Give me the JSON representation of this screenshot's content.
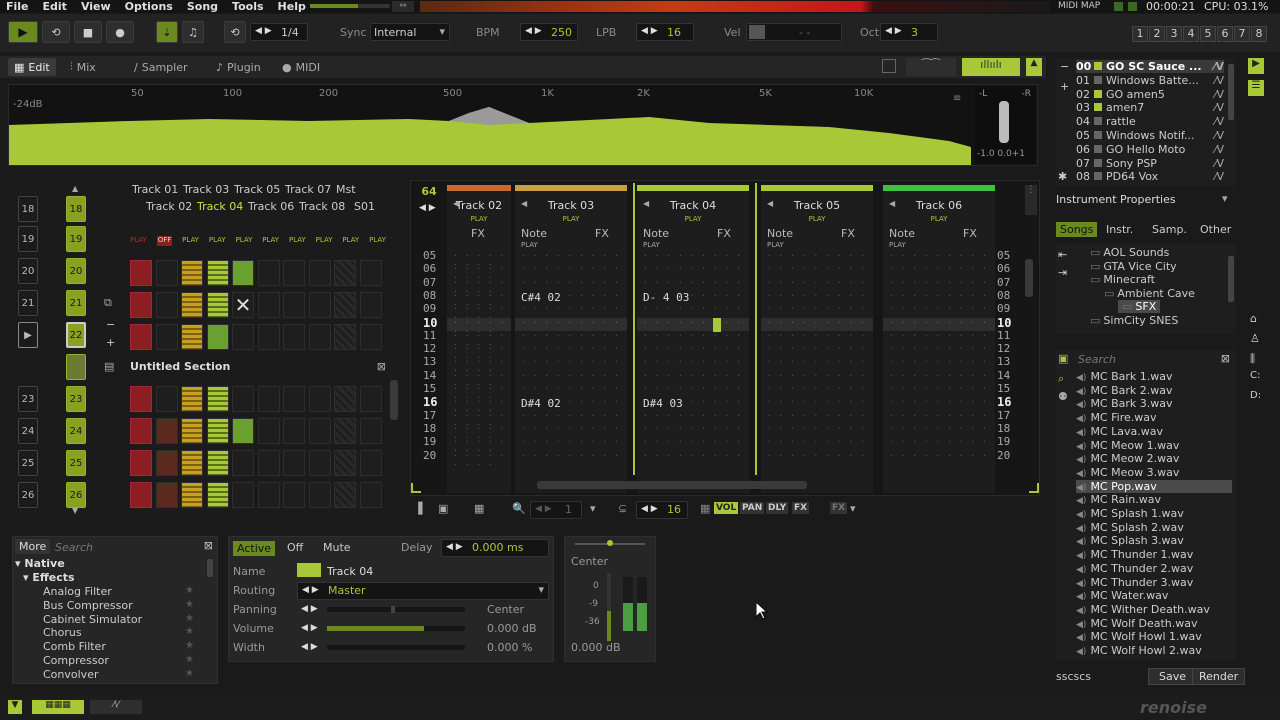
{
  "menu": [
    "File",
    "Edit",
    "View",
    "Options",
    "Song",
    "Tools",
    "Help"
  ],
  "topright": {
    "midi_map": "MIDI MAP",
    "time": "00:00:21",
    "cpu": "CPU: 03.1%"
  },
  "transport": {
    "pattern_pos": "1/4",
    "sync_label": "Sync",
    "sync_value": "Internal",
    "bpm_label": "BPM",
    "bpm": "250",
    "lpb_label": "LPB",
    "lpb": "16",
    "vel_label": "Vel",
    "vel": "- -",
    "oct_label": "Oct",
    "oct": "3",
    "tracks": [
      "1",
      "2",
      "3",
      "4",
      "5",
      "6",
      "7",
      "8"
    ]
  },
  "tabs": [
    "Edit",
    "Mix",
    "Sampler",
    "Plugin",
    "MIDI"
  ],
  "spectrum": {
    "db": "-24dB",
    "freqs": [
      "50",
      "100",
      "200",
      "500",
      "1K",
      "2K",
      "5K",
      "10K"
    ],
    "l": "-L",
    "r": "-R",
    "corr": "-1.0 0.0+1"
  },
  "instruments": [
    {
      "num": "00",
      "name": "GO SC Sauce ..."
    },
    {
      "num": "01",
      "name": "Windows Batte..."
    },
    {
      "num": "02",
      "name": "GO amen5"
    },
    {
      "num": "03",
      "name": "amen7"
    },
    {
      "num": "04",
      "name": "rattle"
    },
    {
      "num": "05",
      "name": "Windows Notif..."
    },
    {
      "num": "06",
      "name": "GO Hello Moto"
    },
    {
      "num": "07",
      "name": "Sony PSP"
    },
    {
      "num": "08",
      "name": "PD64 Vox"
    }
  ],
  "inst_props": "Instrument Properties",
  "browser_tabs": [
    "Songs",
    "Instr.",
    "Samp.",
    "Other"
  ],
  "folders": [
    "AOL Sounds",
    "GTA Vice City",
    "Minecraft",
    "Ambient Cave",
    "SFX",
    "SimCity SNES"
  ],
  "search_placeholder": "Search",
  "samples": [
    "MC Bark 1.wav",
    "MC Bark 2.wav",
    "MC Bark 3.wav",
    "MC Fire.wav",
    "MC Lava.wav",
    "MC Meow 1.wav",
    "MC Meow 2.wav",
    "MC Meow 3.wav",
    "MC Pop.wav",
    "MC Rain.wav",
    "MC Splash 1.wav",
    "MC Splash 2.wav",
    "MC Splash 3.wav",
    "MC Thunder 1.wav",
    "MC Thunder 2.wav",
    "MC Thunder 3.wav",
    "MC Water.wav",
    "MC Wither Death.wav",
    "MC Wolf Death.wav",
    "MC Wolf Howl 1.wav",
    "MC Wolf Howl 2.wav"
  ],
  "save_name": "sscscs",
  "save_label": "Save",
  "render_label": "Render",
  "matrix": {
    "top_tracks": [
      "Track 01",
      "Track 03",
      "Track 05",
      "Track 07",
      "Mst"
    ],
    "bottom_tracks": [
      "Track 02",
      "Track 04",
      "Track 06",
      "Track 08",
      "S01"
    ],
    "seq_nums": [
      "18",
      "19",
      "20",
      "21",
      "22",
      "",
      "23",
      "24",
      "25",
      "26"
    ],
    "section": "Untitled Section"
  },
  "pattern": {
    "lines": "64",
    "columns": [
      {
        "name": "Track 02",
        "sub": [
          "FX"
        ]
      },
      {
        "name": "Track 03",
        "sub": [
          "Note",
          "FX"
        ]
      },
      {
        "name": "Track 04",
        "sub": [
          "Note",
          "FX"
        ]
      },
      {
        "name": "Track 05",
        "sub": [
          "Note",
          "FX"
        ]
      },
      {
        "name": "Track 06",
        "sub": [
          "Note",
          "FX"
        ]
      }
    ],
    "rows": [
      "05",
      "06",
      "07",
      "08",
      "09",
      "10",
      "11",
      "12",
      "13",
      "14",
      "15",
      "16",
      "17",
      "18",
      "19",
      "20"
    ],
    "notes": {
      "t3_08": "C#4 02",
      "t4_08": "D- 4 03",
      "t3_16": "D#4 02",
      "t4_16": "D#4 03"
    },
    "play": "PLAY",
    "off": "OFF",
    "step": "16",
    "edit_step": "1",
    "buttons": [
      "VOL",
      "PAN",
      "DLY",
      "FX"
    ]
  },
  "dsp": {
    "more": "More",
    "search": "Search",
    "native": "Native",
    "effects": "Effects",
    "list": [
      "Analog Filter",
      "Bus Compressor",
      "Cabinet Simulator",
      "Chorus",
      "Comb Filter",
      "Compressor",
      "Convolver"
    ]
  },
  "track": {
    "active": "Active",
    "off": "Off",
    "mute": "Mute",
    "delay_label": "Delay",
    "delay": "0.000 ms",
    "name_label": "Name",
    "name": "Track 04",
    "routing_label": "Routing",
    "routing": "Master",
    "panning_label": "Panning",
    "panning": "Center",
    "volume_label": "Volume",
    "volume": "0.000 dB",
    "width_label": "Width",
    "width": "0.000 %"
  },
  "meter": {
    "center": "Center",
    "db0": "0",
    "db9": "-9",
    "db36": "-36",
    "value": "0.000 dB"
  },
  "right_icons": [
    "C:",
    "D:"
  ]
}
